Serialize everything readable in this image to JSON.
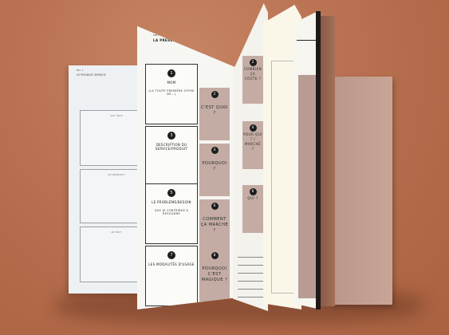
{
  "left_page": {
    "header": "NO 1",
    "header2": "LE PRODUIT SERVICE",
    "boxes": [
      {
        "label": "QUI SUIS"
      },
      {
        "label": "CE PRODUIT"
      },
      {
        "label": "LE MOT"
      }
    ]
  },
  "main_page": {
    "small_title": "MOTIVER",
    "big_title": "LA PRESENTATION",
    "questions": [
      {
        "num": "1",
        "text": "MOM",
        "sub": "(LA TOUTE PREMIÈRE OFFRE DE...)"
      },
      {
        "num": "3",
        "text": "DESCRIPTION DU SERVICE/PRODUIT",
        "sub": ""
      },
      {
        "num": "5",
        "text": "LE PROBLÈME/BESOIN",
        "sub": "QUE JE CONTRIBUE À RÉSOUDRE"
      },
      {
        "num": "7",
        "text": "LES MODALITÉS D'USAGE",
        "sub": ""
      }
    ],
    "answers": [
      {
        "num": "2",
        "text": "C'EST QUOI ?"
      },
      {
        "num": "4",
        "text": "POURQUOI ?"
      },
      {
        "num": "6",
        "text": "COMMENT ÇA MARCHE ?"
      },
      {
        "num": "8",
        "text": "POURQUOI C'EST MAGIQUE ?"
      }
    ]
  },
  "flip_page": {
    "answers": [
      {
        "num": "2",
        "text": "COMBIEN ÇA COÛTE ?"
      },
      {
        "num": "4",
        "text": "POUR QUI ? / MARCHÉ ?"
      },
      {
        "num": "6",
        "text": "QUI ?"
      }
    ]
  },
  "colors": {
    "background": "#b87150",
    "card_accent": "#c4aca4",
    "page": "#f6f6f2",
    "ink": "#1d1d1d"
  }
}
